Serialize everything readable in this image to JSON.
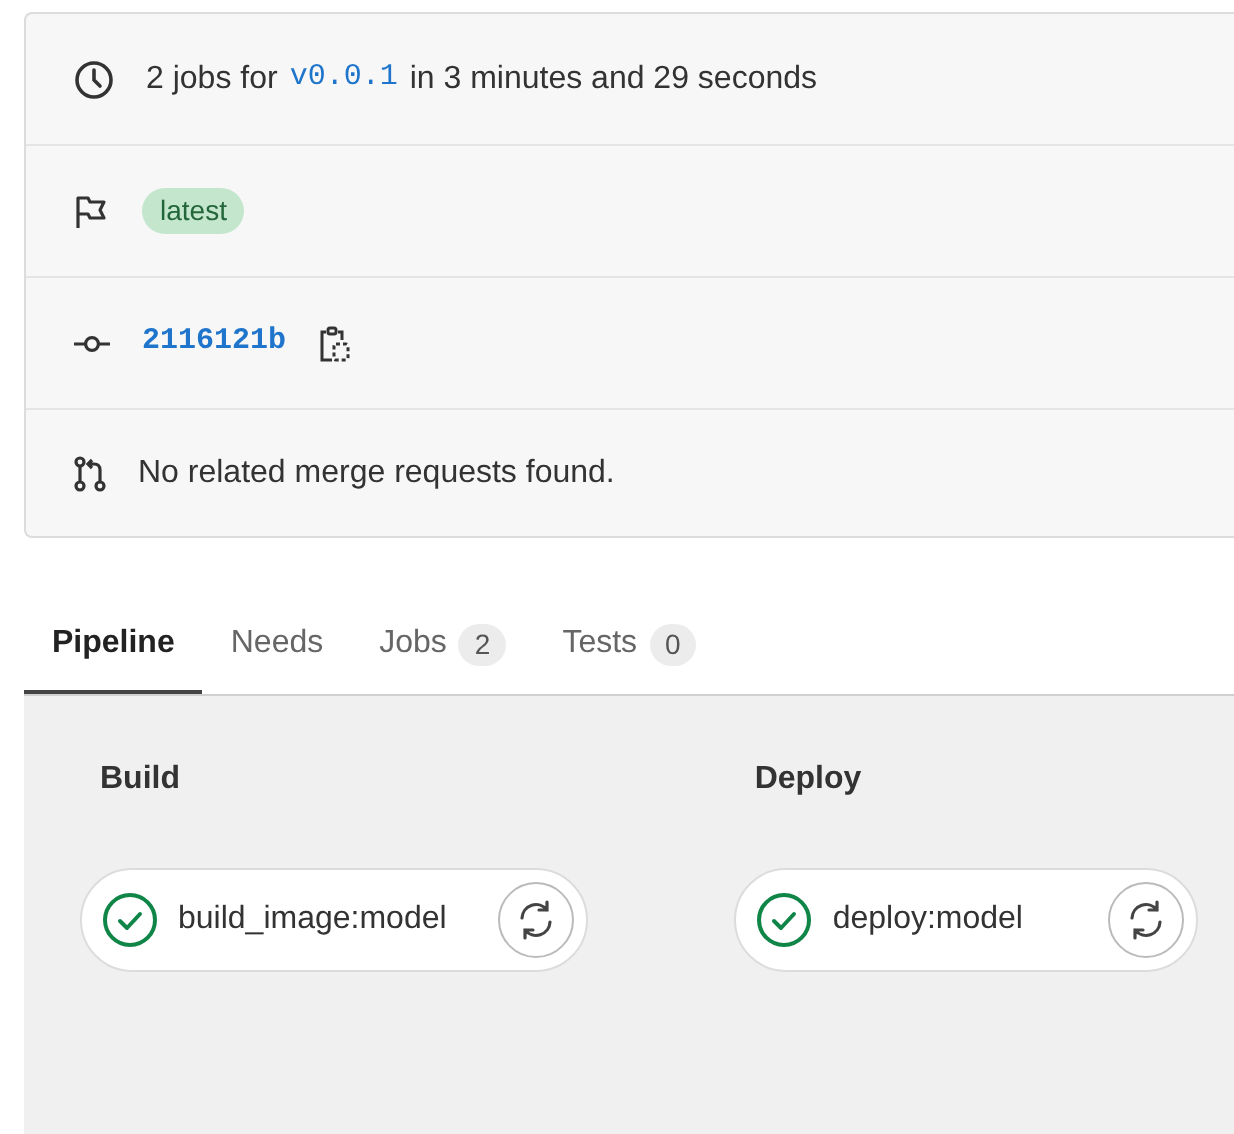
{
  "info": {
    "jobs_prefix": "2 jobs for",
    "ref": "v0.0.1",
    "jobs_suffix": "in 3 minutes and 29 seconds",
    "tag": "latest",
    "commit": "2116121b",
    "merge_requests": "No related merge requests found."
  },
  "tabs": [
    {
      "label": "Pipeline",
      "selected": true
    },
    {
      "label": "Needs",
      "selected": false
    },
    {
      "label": "Jobs",
      "count": "2",
      "selected": false
    },
    {
      "label": "Tests",
      "count": "0",
      "selected": false
    }
  ],
  "stages": [
    {
      "name": "Build",
      "jobs": [
        {
          "name": "build_image:model",
          "passed": true
        }
      ]
    },
    {
      "name": "Deploy",
      "jobs": [
        {
          "name": "deploy:model",
          "passed": true
        }
      ]
    }
  ]
}
